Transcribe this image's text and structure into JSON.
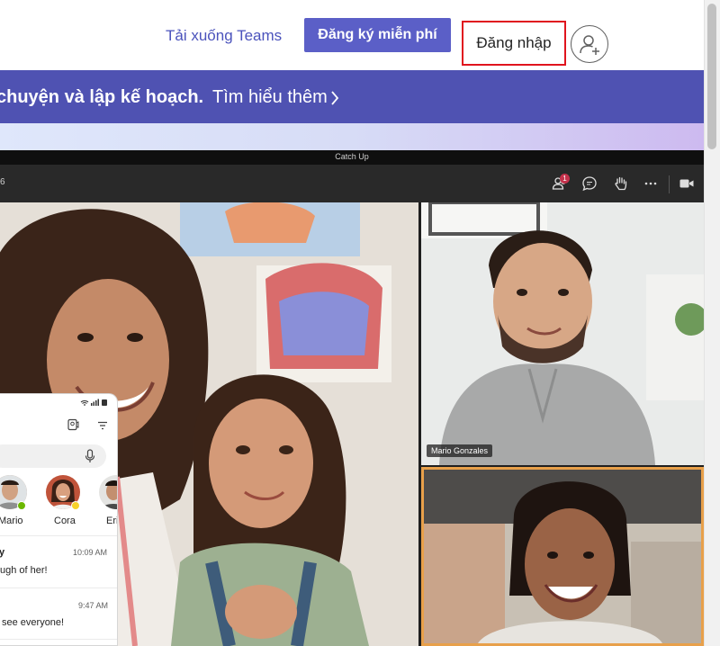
{
  "header": {
    "download_label": "Tải xuống Teams",
    "signup_label": "Đăng ký miễn phí",
    "signin_label": "Đăng nhập",
    "avatar_icon": "add-user-icon"
  },
  "banner": {
    "text": "chuyện và lập kế hoạch.",
    "link_label": "Tìm hiểu thêm",
    "link_icon": "chevron-right-icon",
    "color": "#4f52b2"
  },
  "meeting": {
    "window_title": "Catch Up",
    "timer_fragment": "6",
    "participants_badge": "1",
    "toolbar_icons": [
      "participants-icon",
      "chat-icon",
      "raise-hand-icon",
      "more-icon",
      "camera-icon"
    ],
    "tiles": [
      {
        "name": ""
      },
      {
        "name": "Mario Gonzales"
      },
      {
        "name": ""
      }
    ],
    "active_speaker_color": "#e8a04a"
  },
  "phone": {
    "contacts": [
      {
        "name": "Mario"
      },
      {
        "name": "Cora"
      },
      {
        "name": "Eri"
      }
    ],
    "chats": [
      {
        "sender": "y",
        "time": "10:09 AM",
        "preview": "ugh of her!"
      },
      {
        "sender": "",
        "time": "9:47 AM",
        "preview": "see everyone!"
      }
    ]
  },
  "colors": {
    "brand": "#5b5fc7",
    "highlight_box": "#e0141e"
  }
}
